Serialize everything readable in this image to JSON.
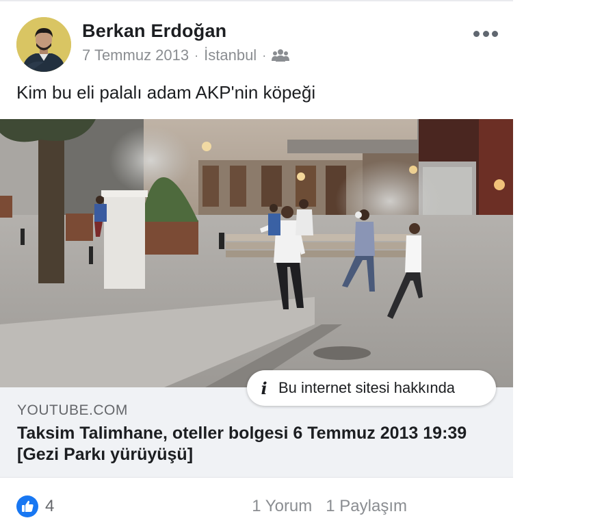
{
  "post": {
    "author": "Berkan Erdoğan",
    "date": "7 Temmuz 2013",
    "separator": "·",
    "location": "İstanbul",
    "audience_icon": "friends-icon",
    "more_icon": "more-options-icon",
    "text": "Kim bu eli palalı adam AKP'nin köpeği"
  },
  "link_preview": {
    "info_label": "Bu internet sitesi hakkında",
    "info_icon": "info-icon",
    "domain": "YOUTUBE.COM",
    "title": "Taksim Talimhane, oteller bolgesi 6 Temmuz 2013 19:39 [Gezi Parkı yürüyüşü]"
  },
  "footer": {
    "like_icon": "thumbs-up-icon",
    "like_count": "4",
    "comments": "1 Yorum",
    "shares": "1 Paylaşım"
  },
  "colors": {
    "like_blue": "#1877f2",
    "muted_text": "#8a8d91",
    "link_background": "#f0f2f5"
  }
}
